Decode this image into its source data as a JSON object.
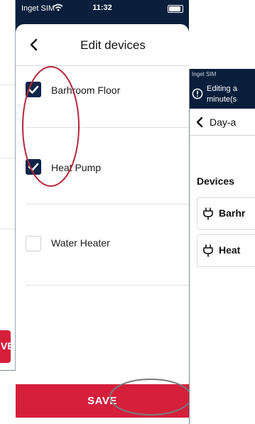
{
  "background_screen": {
    "button_label_fragment": "VE"
  },
  "status_bar": {
    "carrier": "Inget SIM",
    "time": "11:32"
  },
  "edit_devices": {
    "title": "Edit devices",
    "devices": [
      {
        "label": "Barhroom Floor",
        "checked": true
      },
      {
        "label": "Heat Pump",
        "checked": true
      },
      {
        "label": "Water Heater",
        "checked": false
      }
    ],
    "save_label": "SAVE"
  },
  "right_screen": {
    "status_carrier": "Inget SIM",
    "banner_line1": "Editing a",
    "banner_line2": "minute(s",
    "nav_label": "Day-a",
    "devices_heading": "Devices",
    "cards": [
      {
        "name": "Barhr"
      },
      {
        "name": "Heat"
      }
    ]
  },
  "colors": {
    "navy": "#0a1f3c",
    "checkbox_navy": "#0d2547",
    "accent_red": "#d51f3b",
    "annotation_red": "#b5273d",
    "annotation_grey": "#7a7a7a"
  }
}
